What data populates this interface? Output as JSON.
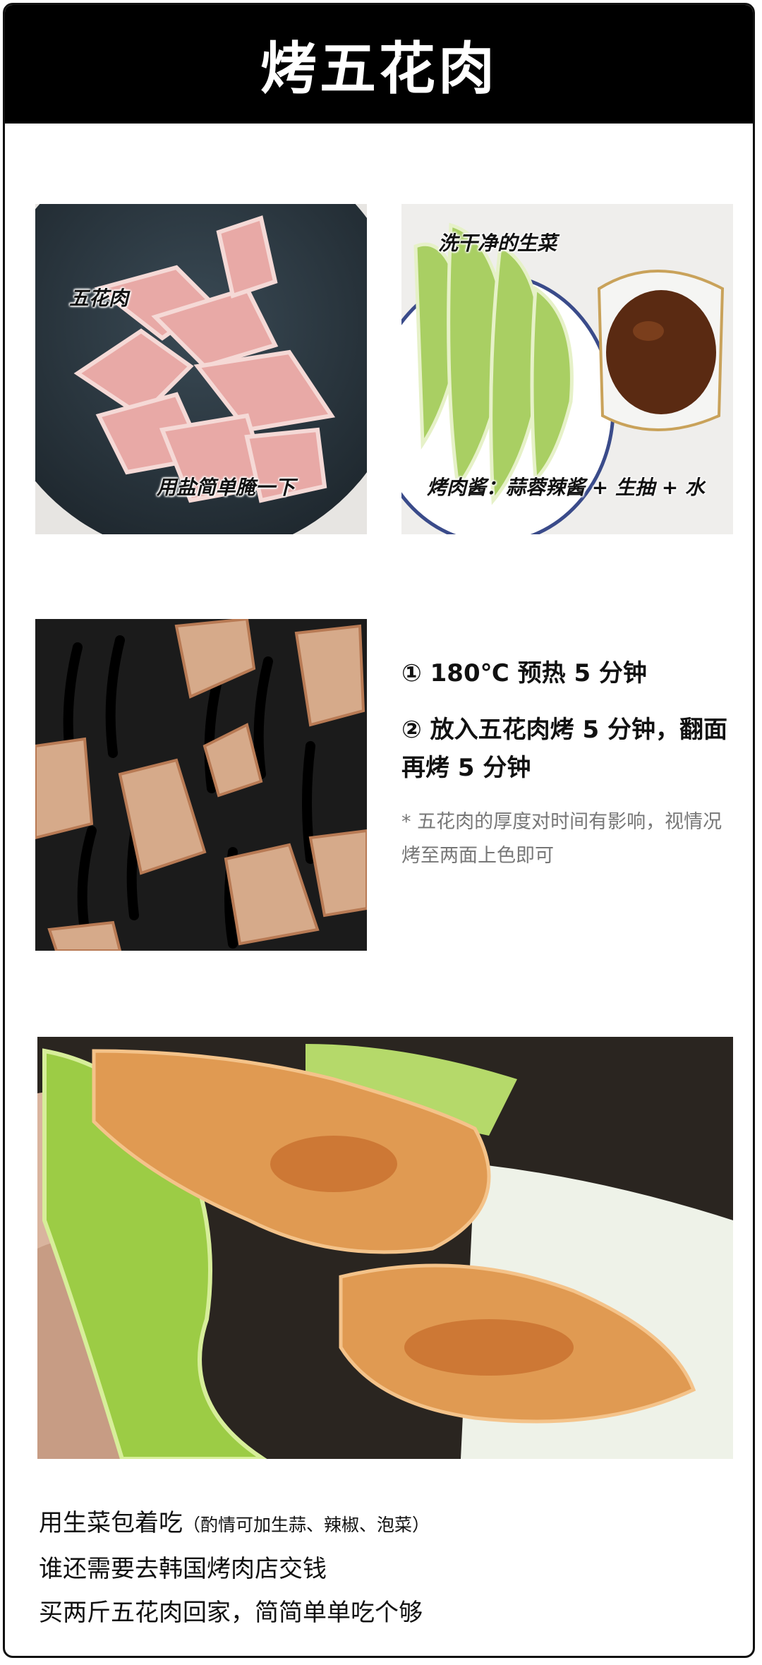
{
  "title": "烤五花肉",
  "photo1": {
    "labels": [
      "五花肉",
      "用盐简单腌一下"
    ]
  },
  "photo2": {
    "labels": [
      "洗干净的生菜",
      "烤肉酱：蒜蓉辣酱 + 生抽 + 水"
    ]
  },
  "steps": [
    "① 180℃ 预热 5 分钟",
    "② 放入五花肉烤 5 分钟，翻面再烤 5 分钟"
  ],
  "note": "* 五花肉的厚度对时间有影响，视情况烤至两面上色即可",
  "closing": {
    "line1_main": "用生菜包着吃",
    "line1_small": "（酌情可加生蒜、辣椒、泡菜）",
    "line2": "谁还需要去韩国烤肉店交钱",
    "line3": "买两斤五花肉回家，简简单单吃个够"
  },
  "colors": {
    "header_bg": "#000000",
    "border": "#111111",
    "note_text": "#777777"
  }
}
